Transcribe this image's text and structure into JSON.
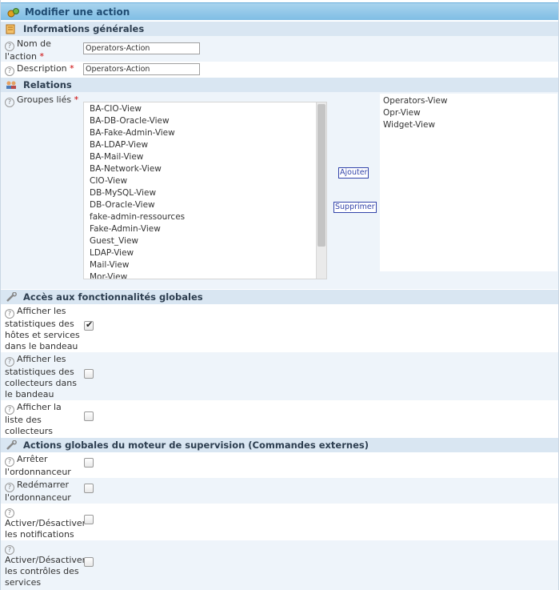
{
  "header": {
    "title": "Modifier une action"
  },
  "sections": {
    "general": "Informations générales",
    "relations": "Relations",
    "global_features": "Accès aux fonctionnalités globales",
    "global_actions": "Actions globales du moteur de supervision (Commandes externes)"
  },
  "fields": {
    "name_label_1": "Nom de",
    "name_label_2": "l'action",
    "name_value": "Operators-Action",
    "description_label": "Description",
    "description_value": "Operators-Action",
    "groups_label": "Groupes liés",
    "required_mark": "*",
    "help_glyph": "?"
  },
  "available_groups": [
    "BA-CIO-View",
    "BA-DB-Oracle-View",
    "BA-Fake-Admin-View",
    "BA-LDAP-View",
    "BA-Mail-View",
    "BA-Network-View",
    "CIO-View",
    "DB-MySQL-View",
    "DB-Oracle-View",
    "fake-admin-ressources",
    "Fake-Admin-View",
    "Guest_View",
    "LDAP-View",
    "Mail-View",
    "Mor-View"
  ],
  "linked_groups": [
    "Operators-View",
    "Opr-View",
    "Widget-View"
  ],
  "buttons": {
    "add": "Ajouter",
    "remove": "Supprimer"
  },
  "features": [
    {
      "lines": [
        "Afficher les",
        "statistiques des",
        "hôtes et services",
        "dans le bandeau"
      ],
      "checked": true
    },
    {
      "lines": [
        "Afficher les",
        "statistiques des",
        "collecteurs dans",
        "le bandeau"
      ],
      "checked": false
    },
    {
      "lines": [
        "Afficher la",
        "liste des",
        "collecteurs"
      ],
      "checked": false
    }
  ],
  "actions": [
    {
      "lines": [
        "Arrêter",
        "l'ordonnanceur"
      ],
      "checked": false
    },
    {
      "lines": [
        "Redémarrer",
        "l'ordonnanceur"
      ],
      "checked": false
    },
    {
      "lines": [
        "Activer/Désactiver",
        "les notifications"
      ],
      "checked": false
    },
    {
      "lines": [
        "Activer/Désactiver",
        "les contrôles des",
        "services"
      ],
      "checked": false
    }
  ]
}
